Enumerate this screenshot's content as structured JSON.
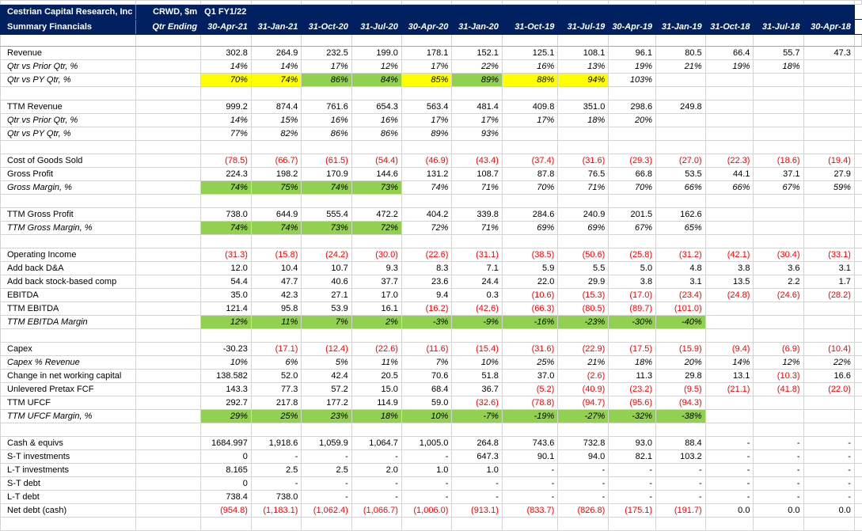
{
  "colors": {
    "header_bg": "#002060",
    "header_text": "#ffffff",
    "negative": "#ff0000",
    "yellow": "#ffff00",
    "green": "#92d050",
    "gridline": "#d4d4d4"
  },
  "header": {
    "company": "Cestrian Capital Research, Inc",
    "subtitle": "Summary Financials",
    "ticker_units": "CRWD, $m",
    "qtr_ending": "Qtr Ending",
    "first_period_label": "Q1 FY1/22",
    "dates": [
      "30-Apr-21",
      "31-Jan-21",
      "31-Oct-20",
      "31-Jul-20",
      "30-Apr-20",
      "31-Jan-20",
      "31-Oct-19",
      "31-Jul-19",
      "30-Apr-19",
      "31-Jan-19",
      "31-Oct-18",
      "31-Jul-18",
      "30-Apr-18"
    ]
  },
  "rows": [
    {
      "label": "Revenue",
      "italic": false,
      "values": [
        "302.8",
        "264.9",
        "232.5",
        "199.0",
        "178.1",
        "152.1",
        "125.1",
        "108.1",
        "96.1",
        "80.5",
        "66.4",
        "55.7",
        "47.3"
      ]
    },
    {
      "label": "Qtr vs Prior Qtr, %",
      "italic": true,
      "values": [
        "14%",
        "14%",
        "17%",
        "12%",
        "17%",
        "22%",
        "16%",
        "13%",
        "19%",
        "21%",
        "19%",
        "18%",
        ""
      ]
    },
    {
      "label": "Qtr vs PY Qtr, %",
      "italic": true,
      "values": [
        "70%",
        "74%",
        "86%",
        "84%",
        "85%",
        "89%",
        "88%",
        "94%",
        "103%",
        "",
        "",
        "",
        ""
      ],
      "highlight": [
        "yellow",
        "yellow",
        "green",
        "green",
        "yellow",
        "green",
        "yellow",
        "yellow",
        "",
        "",
        "",
        "",
        ""
      ]
    },
    {
      "label": "",
      "values": []
    },
    {
      "label": "TTM Revenue",
      "italic": false,
      "values": [
        "999.2",
        "874.4",
        "761.6",
        "654.3",
        "563.4",
        "481.4",
        "409.8",
        "351.0",
        "298.6",
        "249.8",
        "",
        "",
        ""
      ]
    },
    {
      "label": "Qtr vs Prior Qtr, %",
      "italic": true,
      "values": [
        "14%",
        "15%",
        "16%",
        "16%",
        "17%",
        "17%",
        "17%",
        "18%",
        "20%",
        "",
        "",
        "",
        ""
      ]
    },
    {
      "label": "Qtr vs PY Qtr, %",
      "italic": true,
      "values": [
        "77%",
        "82%",
        "86%",
        "86%",
        "89%",
        "93%",
        "",
        "",
        "",
        "",
        "",
        "",
        ""
      ]
    },
    {
      "label": "",
      "values": []
    },
    {
      "label": "Cost of Goods Sold",
      "italic": false,
      "values": [
        "(78.5)",
        "(66.7)",
        "(61.5)",
        "(54.4)",
        "(46.9)",
        "(43.4)",
        "(37.4)",
        "(31.6)",
        "(29.3)",
        "(27.0)",
        "(22.3)",
        "(18.6)",
        "(19.4)"
      ]
    },
    {
      "label": "Gross Profit",
      "italic": false,
      "values": [
        "224.3",
        "198.2",
        "170.9",
        "144.6",
        "131.2",
        "108.7",
        "87.8",
        "76.5",
        "66.8",
        "53.5",
        "44.1",
        "37.1",
        "27.9"
      ]
    },
    {
      "label": "Gross Margin, %",
      "italic": true,
      "values": [
        "74%",
        "75%",
        "74%",
        "73%",
        "74%",
        "71%",
        "70%",
        "71%",
        "70%",
        "66%",
        "66%",
        "67%",
        "59%"
      ],
      "highlight": [
        "green",
        "green",
        "green",
        "green"
      ]
    },
    {
      "label": "",
      "values": []
    },
    {
      "label": "TTM Gross Profit",
      "italic": false,
      "values": [
        "738.0",
        "644.9",
        "555.4",
        "472.2",
        "404.2",
        "339.8",
        "284.6",
        "240.9",
        "201.5",
        "162.6",
        "",
        "",
        ""
      ]
    },
    {
      "label": "TTM Gross Margin, %",
      "italic": true,
      "values": [
        "74%",
        "74%",
        "73%",
        "72%",
        "72%",
        "71%",
        "69%",
        "69%",
        "67%",
        "65%",
        "",
        "",
        ""
      ],
      "highlight": [
        "green",
        "green",
        "green",
        "green"
      ]
    },
    {
      "label": "",
      "values": []
    },
    {
      "label": "Operating Income",
      "italic": false,
      "values": [
        "(31.3)",
        "(15.8)",
        "(24.2)",
        "(30.0)",
        "(22.6)",
        "(31.1)",
        "(38.5)",
        "(50.6)",
        "(25.8)",
        "(31.2)",
        "(42.1)",
        "(30.4)",
        "(33.1)"
      ]
    },
    {
      "label": "Add back D&A",
      "italic": false,
      "values": [
        "12.0",
        "10.4",
        "10.7",
        "9.3",
        "8.3",
        "7.1",
        "5.9",
        "5.5",
        "5.0",
        "4.8",
        "3.8",
        "3.6",
        "3.1"
      ]
    },
    {
      "label": "Add back stock-based comp",
      "italic": false,
      "values": [
        "54.4",
        "47.7",
        "40.6",
        "37.7",
        "23.6",
        "24.4",
        "22.0",
        "29.9",
        "3.8",
        "3.1",
        "13.5",
        "2.2",
        "1.7"
      ]
    },
    {
      "label": "EBITDA",
      "italic": false,
      "values": [
        "35.0",
        "42.3",
        "27.1",
        "17.0",
        "9.4",
        "0.3",
        "(10.6)",
        "(15.3)",
        "(17.0)",
        "(23.4)",
        "(24.8)",
        "(24.6)",
        "(28.2)"
      ]
    },
    {
      "label": "TTM EBITDA",
      "italic": false,
      "values": [
        "121.4",
        "95.8",
        "53.9",
        "16.1",
        "(16.2)",
        "(42.6)",
        "(66.3)",
        "(80.5)",
        "(89.7)",
        "(101.0)",
        "",
        "",
        ""
      ]
    },
    {
      "label": "TTM EBITDA Margin",
      "italic": true,
      "values": [
        "12%",
        "11%",
        "7%",
        "2%",
        "-3%",
        "-9%",
        "-16%",
        "-23%",
        "-30%",
        "-40%",
        "",
        "",
        ""
      ],
      "highlight": [
        "green",
        "green",
        "green",
        "green",
        "green",
        "green",
        "green",
        "green",
        "green",
        "green"
      ]
    },
    {
      "label": "",
      "values": []
    },
    {
      "label": "Capex",
      "italic": false,
      "values": [
        "-30.23",
        "(17.1)",
        "(12.4)",
        "(22.6)",
        "(11.6)",
        "(15.4)",
        "(31.6)",
        "(22.9)",
        "(17.5)",
        "(15.9)",
        "(9.4)",
        "(6.9)",
        "(10.4)"
      ]
    },
    {
      "label": "Capex % Revenue",
      "italic": true,
      "values": [
        "10%",
        "6%",
        "5%",
        "11%",
        "7%",
        "10%",
        "25%",
        "21%",
        "18%",
        "20%",
        "14%",
        "12%",
        "22%"
      ]
    },
    {
      "label": "Change in net working capital",
      "italic": false,
      "values": [
        "138.582",
        "52.0",
        "42.4",
        "20.5",
        "70.6",
        "51.8",
        "37.0",
        "(2.6)",
        "11.3",
        "29.8",
        "13.1",
        "(10.3)",
        "16.6"
      ]
    },
    {
      "label": "Unlevered Pretax FCF",
      "italic": false,
      "values": [
        "143.3",
        "77.3",
        "57.2",
        "15.0",
        "68.4",
        "36.7",
        "(5.2)",
        "(40.9)",
        "(23.2)",
        "(9.5)",
        "(21.1)",
        "(41.8)",
        "(22.0)"
      ]
    },
    {
      "label": "TTM UFCF",
      "italic": false,
      "values": [
        "292.7",
        "217.8",
        "177.2",
        "114.9",
        "59.0",
        "(32.6)",
        "(78.8)",
        "(94.7)",
        "(95.6)",
        "(94.3)",
        "",
        "",
        ""
      ]
    },
    {
      "label": "TTM UFCF Margin, %",
      "italic": true,
      "values": [
        "29%",
        "25%",
        "23%",
        "18%",
        "10%",
        "-7%",
        "-19%",
        "-27%",
        "-32%",
        "-38%",
        "",
        "",
        ""
      ],
      "highlight": [
        "green",
        "green",
        "green",
        "green",
        "green",
        "green",
        "green",
        "green",
        "green",
        "green"
      ]
    },
    {
      "label": "",
      "values": []
    },
    {
      "label": "Cash & equivs",
      "italic": false,
      "values": [
        "1684.997",
        "1,918.6",
        "1,059.9",
        "1,064.7",
        "1,005.0",
        "264.8",
        "743.6",
        "732.8",
        "93.0",
        "88.4",
        "-",
        "-",
        "-"
      ]
    },
    {
      "label": "S-T investments",
      "italic": false,
      "values": [
        "0",
        "-",
        "-",
        "-",
        "-",
        "647.3",
        "90.1",
        "94.0",
        "82.1",
        "103.2",
        "-",
        "-",
        "-"
      ]
    },
    {
      "label": "L-T investments",
      "italic": false,
      "values": [
        "8.165",
        "2.5",
        "2.5",
        "2.0",
        "1.0",
        "1.0",
        "-",
        "-",
        "-",
        "-",
        "-",
        "-",
        "-"
      ]
    },
    {
      "label": "S-T debt",
      "italic": false,
      "values": [
        "0",
        "-",
        "-",
        "-",
        "-",
        "-",
        "-",
        "-",
        "-",
        "-",
        "-",
        "-",
        "-"
      ]
    },
    {
      "label": "L-T debt",
      "italic": false,
      "values": [
        "738.4",
        "738.0",
        "-",
        "-",
        "-",
        "-",
        "-",
        "-",
        "-",
        "-",
        "-",
        "-",
        "-"
      ]
    },
    {
      "label": "Net debt (cash)",
      "italic": false,
      "values": [
        "(954.8)",
        "(1,183.1)",
        "(1,062.4)",
        "(1,066.7)",
        "(1,006.0)",
        "(913.1)",
        "(833.7)",
        "(826.8)",
        "(175.1)",
        "(191.7)",
        "0.0",
        "0.0",
        "0.0"
      ]
    },
    {
      "label": "",
      "values": []
    }
  ]
}
